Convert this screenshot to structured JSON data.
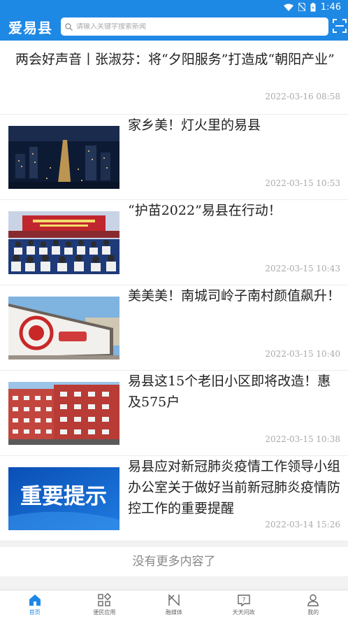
{
  "status_bar": {
    "time": "1:46"
  },
  "header": {
    "app_title": "爱易县",
    "search_placeholder": "请输入关键字搜索新闻"
  },
  "news": [
    {
      "title": "两会好声音丨张淑芬：将“夕阳服务”打造成“朝阳产业”",
      "time": "2022-03-16 08:58",
      "image": null
    },
    {
      "title": "家乡美！灯火里的易县",
      "time": "2022-03-15 10:53",
      "image": "night-city-lights"
    },
    {
      "title": "“护苗2022”易县在行动！",
      "time": "2022-03-15 10:43",
      "image": "auditorium-meeting"
    },
    {
      "title": "美美美！南城司岭子南村颜值飙升！",
      "time": "2022-03-15 10:40",
      "image": "painted-village-wall"
    },
    {
      "title": "易县这15个老旧小区即将改造！惠及575户",
      "time": "2022-03-15 10:38",
      "image": "red-apartment-buildings"
    },
    {
      "title": "易县应对新冠肺炎疫情工作领导小组办公室关于做好当前新冠肺炎疫情防控工作的重要提醒",
      "time": "2022-03-14 15:26",
      "image": "notice-banner"
    }
  ],
  "notice_banner_text": "重要提示",
  "end_message": "没有更多内容了",
  "tabs": [
    {
      "label": "首页",
      "icon": "home-icon",
      "active": true
    },
    {
      "label": "便民应用",
      "icon": "apps-grid-icon",
      "active": false
    },
    {
      "label": "融媒体",
      "icon": "media-icon",
      "active": false
    },
    {
      "label": "天天问政",
      "icon": "question-chat-icon",
      "active": false
    },
    {
      "label": "我的",
      "icon": "user-icon",
      "active": false
    }
  ],
  "colors": {
    "primary": "#1e88e5",
    "tab_active": "#1e88e5",
    "time_text": "#aaaaaa"
  }
}
